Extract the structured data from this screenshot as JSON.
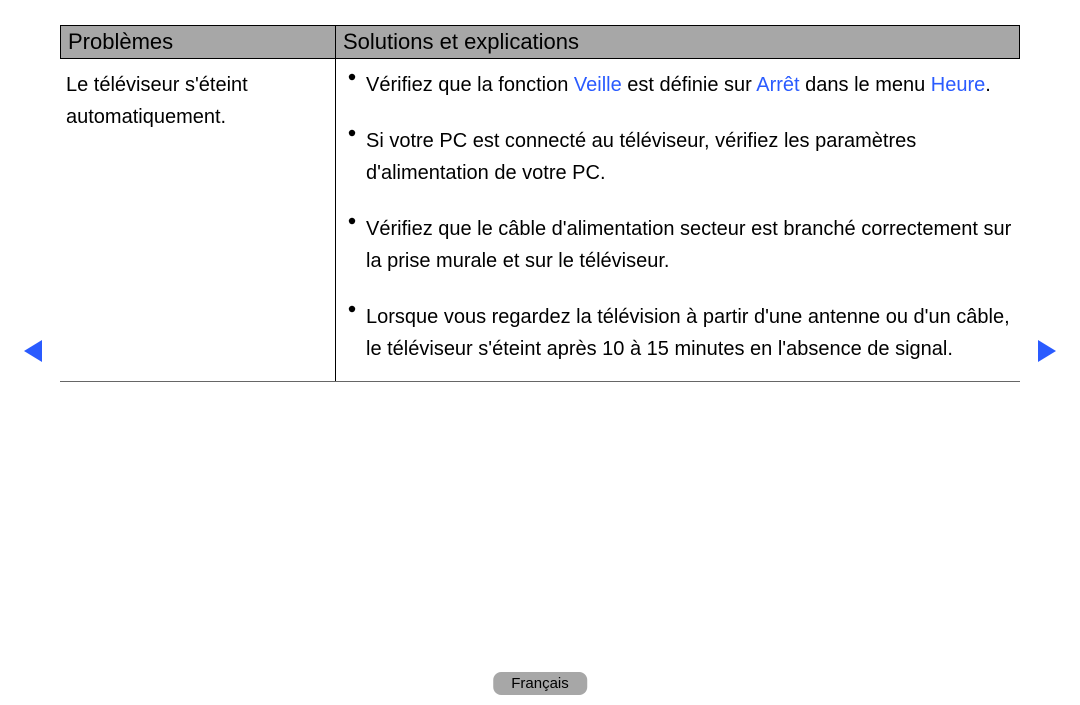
{
  "header": {
    "left": "Problèmes",
    "right": "Solutions et explications"
  },
  "left_col": {
    "line1a": "Le téléviseur s'éteint",
    "line1b": "automatiquement."
  },
  "bullets": [
    {
      "pre": "Vérifiez que la fonction ",
      "link1": "Veille",
      "mid": " est définie sur ",
      "link2": "Arrêt",
      "post1": " dans le menu ",
      "link3": "Heure",
      "post2": "."
    },
    {
      "text": "Si votre PC est connecté au téléviseur, vérifiez les paramètres d'alimentation de votre PC."
    },
    {
      "text": "Vérifiez que le câble d'alimentation secteur est branché correctement sur la prise murale et sur le téléviseur."
    },
    {
      "text": "Lorsque vous regardez la télévision à partir d'une antenne ou d'un câble, le téléviseur s'éteint après 10 à 15 minutes en l'absence de signal."
    }
  ],
  "language": "Français"
}
